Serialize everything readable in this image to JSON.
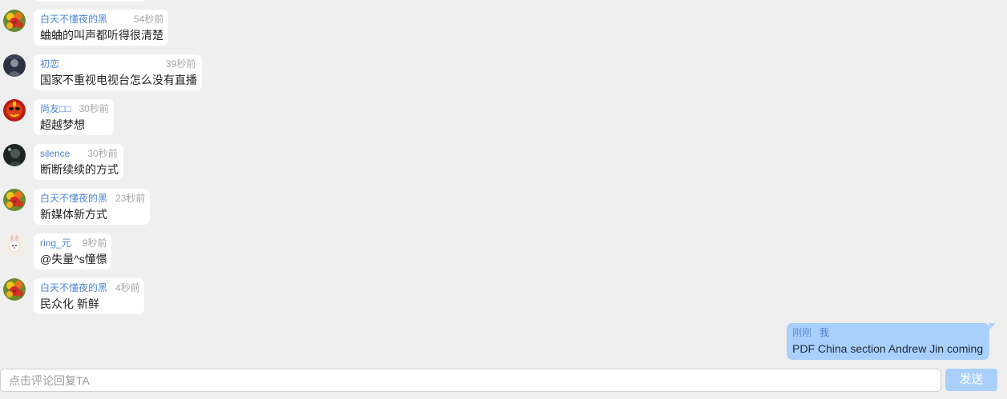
{
  "messages": [
    {
      "user": "白天不懂夜的黑",
      "time": "54秒前",
      "text": "蛐蛐的叫声都听得很清楚",
      "avatar": "flower-avatar"
    },
    {
      "user": "初恋",
      "time": "39秒前",
      "text": "国家不重视电视台怎么没有直播",
      "avatar": "man-avatar"
    },
    {
      "user": "尚友□□",
      "time": "30秒前",
      "text": "超越梦想",
      "avatar": "red-mask-avatar"
    },
    {
      "user": "silence",
      "time": "30秒前",
      "text": "断断续续的方式",
      "avatar": "dark-avatar"
    },
    {
      "user": "白天不懂夜的黑",
      "time": "23秒前",
      "text": "新媒体新方式",
      "avatar": "flower-avatar"
    },
    {
      "user": "ring_元",
      "time": "9秒前",
      "text": "@失量^s憧憬",
      "avatar": "cartoon-avatar"
    },
    {
      "user": "白天不懂夜的黑",
      "time": "4秒前",
      "text": "民众化 新鲜",
      "avatar": "flower-avatar"
    }
  ],
  "my_message": {
    "time": "刚刚",
    "me_label": "我",
    "text": "PDF China section Andrew Jin coming"
  },
  "composer": {
    "placeholder": "点击评论回复TA",
    "send_label": "发送"
  },
  "colors": {
    "background": "#efeff0",
    "username": "#4b86d4",
    "timestamp": "#a6a6a6",
    "my_bubble": "#a9d0fb",
    "send_button": "#a9d0fb"
  }
}
